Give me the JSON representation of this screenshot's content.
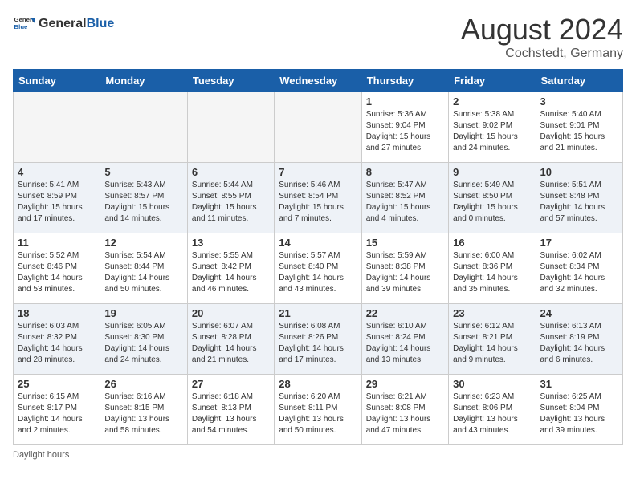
{
  "header": {
    "logo_general": "General",
    "logo_blue": "Blue",
    "month": "August 2024",
    "location": "Cochstedt, Germany"
  },
  "days_of_week": [
    "Sunday",
    "Monday",
    "Tuesday",
    "Wednesday",
    "Thursday",
    "Friday",
    "Saturday"
  ],
  "weeks": [
    [
      {
        "day": "",
        "info": ""
      },
      {
        "day": "",
        "info": ""
      },
      {
        "day": "",
        "info": ""
      },
      {
        "day": "",
        "info": ""
      },
      {
        "day": "1",
        "info": "Sunrise: 5:36 AM\nSunset: 9:04 PM\nDaylight: 15 hours\nand 27 minutes."
      },
      {
        "day": "2",
        "info": "Sunrise: 5:38 AM\nSunset: 9:02 PM\nDaylight: 15 hours\nand 24 minutes."
      },
      {
        "day": "3",
        "info": "Sunrise: 5:40 AM\nSunset: 9:01 PM\nDaylight: 15 hours\nand 21 minutes."
      }
    ],
    [
      {
        "day": "4",
        "info": "Sunrise: 5:41 AM\nSunset: 8:59 PM\nDaylight: 15 hours\nand 17 minutes."
      },
      {
        "day": "5",
        "info": "Sunrise: 5:43 AM\nSunset: 8:57 PM\nDaylight: 15 hours\nand 14 minutes."
      },
      {
        "day": "6",
        "info": "Sunrise: 5:44 AM\nSunset: 8:55 PM\nDaylight: 15 hours\nand 11 minutes."
      },
      {
        "day": "7",
        "info": "Sunrise: 5:46 AM\nSunset: 8:54 PM\nDaylight: 15 hours\nand 7 minutes."
      },
      {
        "day": "8",
        "info": "Sunrise: 5:47 AM\nSunset: 8:52 PM\nDaylight: 15 hours\nand 4 minutes."
      },
      {
        "day": "9",
        "info": "Sunrise: 5:49 AM\nSunset: 8:50 PM\nDaylight: 15 hours\nand 0 minutes."
      },
      {
        "day": "10",
        "info": "Sunrise: 5:51 AM\nSunset: 8:48 PM\nDaylight: 14 hours\nand 57 minutes."
      }
    ],
    [
      {
        "day": "11",
        "info": "Sunrise: 5:52 AM\nSunset: 8:46 PM\nDaylight: 14 hours\nand 53 minutes."
      },
      {
        "day": "12",
        "info": "Sunrise: 5:54 AM\nSunset: 8:44 PM\nDaylight: 14 hours\nand 50 minutes."
      },
      {
        "day": "13",
        "info": "Sunrise: 5:55 AM\nSunset: 8:42 PM\nDaylight: 14 hours\nand 46 minutes."
      },
      {
        "day": "14",
        "info": "Sunrise: 5:57 AM\nSunset: 8:40 PM\nDaylight: 14 hours\nand 43 minutes."
      },
      {
        "day": "15",
        "info": "Sunrise: 5:59 AM\nSunset: 8:38 PM\nDaylight: 14 hours\nand 39 minutes."
      },
      {
        "day": "16",
        "info": "Sunrise: 6:00 AM\nSunset: 8:36 PM\nDaylight: 14 hours\nand 35 minutes."
      },
      {
        "day": "17",
        "info": "Sunrise: 6:02 AM\nSunset: 8:34 PM\nDaylight: 14 hours\nand 32 minutes."
      }
    ],
    [
      {
        "day": "18",
        "info": "Sunrise: 6:03 AM\nSunset: 8:32 PM\nDaylight: 14 hours\nand 28 minutes."
      },
      {
        "day": "19",
        "info": "Sunrise: 6:05 AM\nSunset: 8:30 PM\nDaylight: 14 hours\nand 24 minutes."
      },
      {
        "day": "20",
        "info": "Sunrise: 6:07 AM\nSunset: 8:28 PM\nDaylight: 14 hours\nand 21 minutes."
      },
      {
        "day": "21",
        "info": "Sunrise: 6:08 AM\nSunset: 8:26 PM\nDaylight: 14 hours\nand 17 minutes."
      },
      {
        "day": "22",
        "info": "Sunrise: 6:10 AM\nSunset: 8:24 PM\nDaylight: 14 hours\nand 13 minutes."
      },
      {
        "day": "23",
        "info": "Sunrise: 6:12 AM\nSunset: 8:21 PM\nDaylight: 14 hours\nand 9 minutes."
      },
      {
        "day": "24",
        "info": "Sunrise: 6:13 AM\nSunset: 8:19 PM\nDaylight: 14 hours\nand 6 minutes."
      }
    ],
    [
      {
        "day": "25",
        "info": "Sunrise: 6:15 AM\nSunset: 8:17 PM\nDaylight: 14 hours\nand 2 minutes."
      },
      {
        "day": "26",
        "info": "Sunrise: 6:16 AM\nSunset: 8:15 PM\nDaylight: 13 hours\nand 58 minutes."
      },
      {
        "day": "27",
        "info": "Sunrise: 6:18 AM\nSunset: 8:13 PM\nDaylight: 13 hours\nand 54 minutes."
      },
      {
        "day": "28",
        "info": "Sunrise: 6:20 AM\nSunset: 8:11 PM\nDaylight: 13 hours\nand 50 minutes."
      },
      {
        "day": "29",
        "info": "Sunrise: 6:21 AM\nSunset: 8:08 PM\nDaylight: 13 hours\nand 47 minutes."
      },
      {
        "day": "30",
        "info": "Sunrise: 6:23 AM\nSunset: 8:06 PM\nDaylight: 13 hours\nand 43 minutes."
      },
      {
        "day": "31",
        "info": "Sunrise: 6:25 AM\nSunset: 8:04 PM\nDaylight: 13 hours\nand 39 minutes."
      }
    ]
  ],
  "footer": "Daylight hours"
}
